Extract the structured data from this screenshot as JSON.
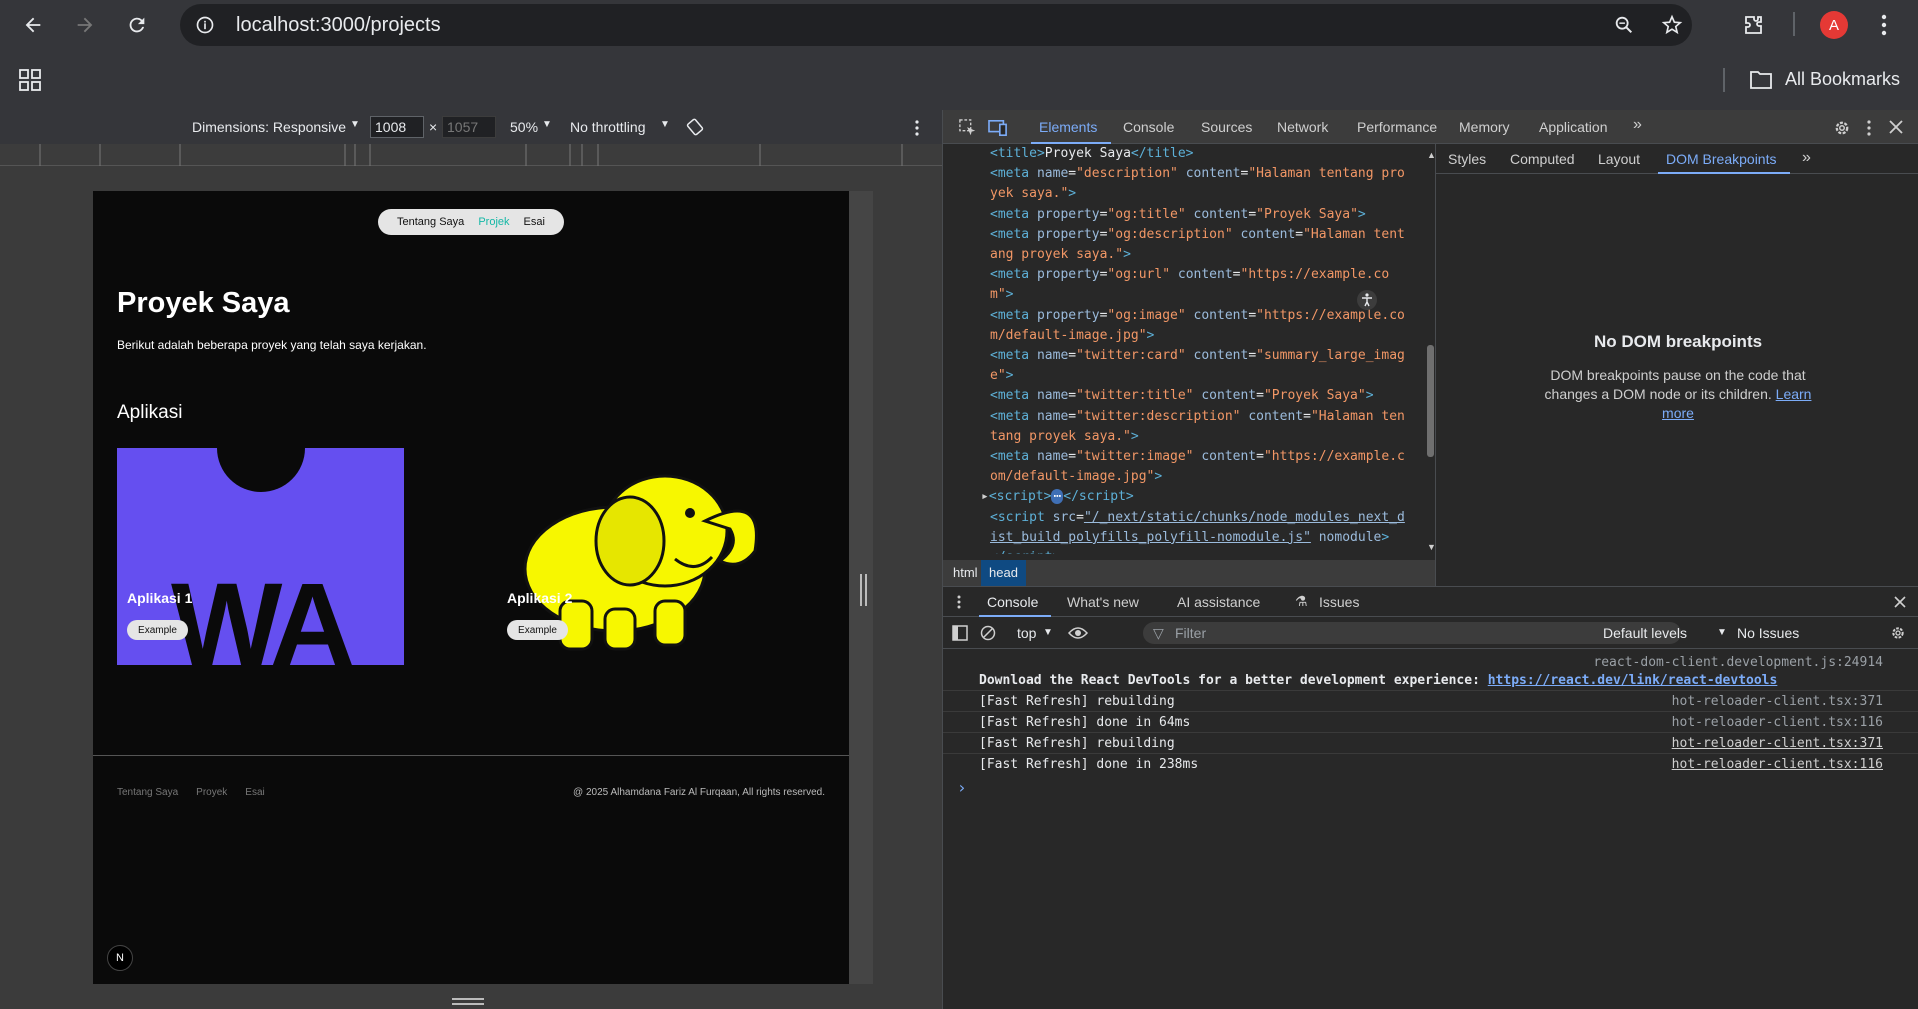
{
  "browser": {
    "url": "localhost:3000/projects",
    "bookmarks_label": "All Bookmarks",
    "profile_initial": "A",
    "icons": [
      "back-icon",
      "forward-icon",
      "reload-icon",
      "info-icon",
      "zoom-icon",
      "star-icon",
      "extensions-icon",
      "apps-icon",
      "folder-icon"
    ]
  },
  "device_toolbar": {
    "dimensions_label": "Dimensions: Responsive",
    "width": "1008",
    "height": "1057",
    "times": "×",
    "zoom": "50%",
    "throttling": "No throttling"
  },
  "page": {
    "nav": [
      "Tentang Saya",
      "Projek",
      "Esai"
    ],
    "nav_active": "Projek",
    "title": "Proyek Saya",
    "description": "Berikut adalah beberapa proyek yang telah saya kerjakan.",
    "section": "Aplikasi",
    "cards": [
      {
        "title": "Aplikasi 1",
        "badge": "Example",
        "image": "webassembly-logo",
        "logo_text": "WA"
      },
      {
        "title": "Aplikasi 2",
        "badge": "Example",
        "image": "hadoop-elephant"
      }
    ],
    "footer_links": [
      "Tentang Saya",
      "Proyek",
      "Esai"
    ],
    "copyright": "@ 2025 Alhamdana Fariz Al Furqaan, All rights reserved.",
    "next_logo": "N"
  },
  "devtools": {
    "tabs": [
      "Elements",
      "Console",
      "Sources",
      "Network",
      "Performance",
      "Memory",
      "Application"
    ],
    "active_tab": "Elements",
    "breadcrumb": [
      "html",
      "head"
    ],
    "side_tabs": [
      "Styles",
      "Computed",
      "Layout",
      "DOM Breakpoints"
    ],
    "active_side_tab": "DOM Breakpoints",
    "no_breakpoints_title": "No DOM breakpoints",
    "no_breakpoints_desc": "DOM breakpoints pause on the code that changes a DOM node or its children.",
    "learn_more": "Learn more",
    "drawer_tabs": [
      "Console",
      "What's new",
      "AI assistance",
      "Issues"
    ],
    "console_context": "top",
    "filter_placeholder": "Filter",
    "default_levels": "Default levels",
    "no_issues": "No Issues",
    "console_logs": [
      {
        "src": "react-dom-client.development.js:24914",
        "msg": "",
        "link": ""
      },
      {
        "src": "",
        "msg": "Download the React DevTools for a better development experience: ",
        "link": "https://react.dev/link/react-devtools"
      },
      {
        "src": "hot-reloader-client.tsx:371",
        "msg": "[Fast Refresh] rebuilding",
        "link": ""
      },
      {
        "src": "hot-reloader-client.tsx:116",
        "msg": "[Fast Refresh] done in 64ms",
        "link": ""
      },
      {
        "src": "hot-reloader-client.tsx:371",
        "msg": "[Fast Refresh] rebuilding",
        "link": ""
      },
      {
        "src": "hot-reloader-client.tsx:116",
        "msg": "[Fast Refresh] done in 238ms",
        "link": ""
      }
    ],
    "prompt": "›"
  }
}
